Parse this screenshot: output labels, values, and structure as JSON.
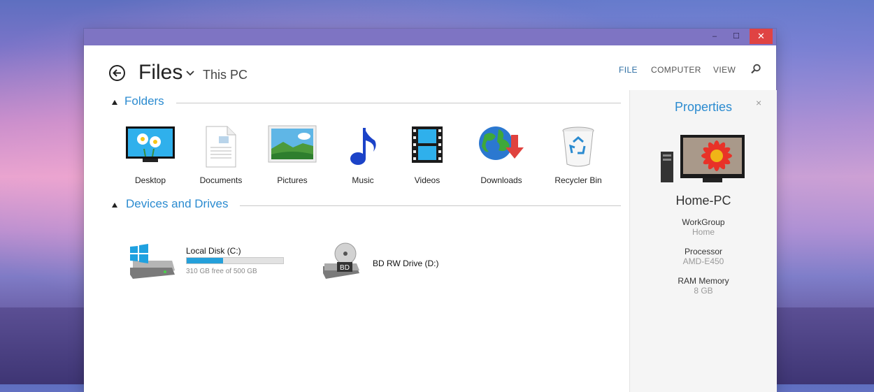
{
  "window": {
    "min_glyph": "–",
    "max_glyph": "☐",
    "close_glyph": "✕"
  },
  "header": {
    "app_title": "Files",
    "location": "This PC"
  },
  "menu": {
    "file": "FILE",
    "computer": "COMPUTER",
    "view": "VIEW"
  },
  "sections": {
    "folders": "Folders",
    "devices": "Devices and Drives"
  },
  "folders": [
    {
      "label": "Desktop",
      "icon": "desktop-icon"
    },
    {
      "label": "Documents",
      "icon": "documents-icon"
    },
    {
      "label": "Pictures",
      "icon": "pictures-icon"
    },
    {
      "label": "Music",
      "icon": "music-icon"
    },
    {
      "label": "Videos",
      "icon": "videos-icon"
    },
    {
      "label": "Downloads",
      "icon": "downloads-icon"
    },
    {
      "label": "Recycler Bin",
      "icon": "recycle-bin-icon"
    }
  ],
  "drives": [
    {
      "name": "Local Disk (C:)",
      "free_text": "310 GB free of 500 GB",
      "used_fraction": 0.38,
      "icon": "windows-drive-icon"
    },
    {
      "name": "BD RW Drive (D:)",
      "icon": "bd-drive-icon",
      "badge": "BD"
    }
  ],
  "properties": {
    "title": "Properties",
    "close_glyph": "×",
    "computer_name": "Home-PC",
    "items": [
      {
        "label": "WorkGroup",
        "value": "Home"
      },
      {
        "label": "Processor",
        "value": "AMD-E450"
      },
      {
        "label": "RAM Memory",
        "value": "8 GB"
      }
    ]
  },
  "colors": {
    "accent": "#2b8bd0",
    "titlebar": "#7e74c3",
    "close": "#e04343",
    "disk_fill": "#25a0da"
  }
}
